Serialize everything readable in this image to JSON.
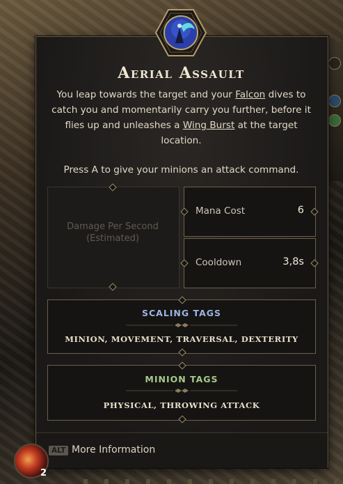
{
  "skill": {
    "title": "Aerial Assault",
    "description_parts": {
      "p1": "You leap towards the target and your ",
      "link1": "Falcon",
      "p2": " dives to catch you and momentarily carry you further, before it flies up and unleashes a ",
      "link2": "Wing Burst",
      "p3": " at the target location."
    },
    "command_hint": "Press A to give your minions an attack command."
  },
  "stats": {
    "dps_label": "Damage Per Second (Estimated)",
    "mana_cost_label": "Mana Cost",
    "mana_cost_value": "6",
    "cooldown_label": "Cooldown",
    "cooldown_value": "3,8s"
  },
  "scaling_tags": {
    "title": "SCALING TAGS",
    "title_color": "#9fb4e0",
    "list": "MINION, MOVEMENT, TRAVERSAL, DEXTERITY"
  },
  "minion_tags": {
    "title": "MINION TAGS",
    "title_color": "#a9c98a",
    "list": "PHYSICAL, THROWING ATTACK"
  },
  "footer": {
    "alt_key": "ALT",
    "more_info": "More Information"
  },
  "hud": {
    "orb_count": "2"
  }
}
